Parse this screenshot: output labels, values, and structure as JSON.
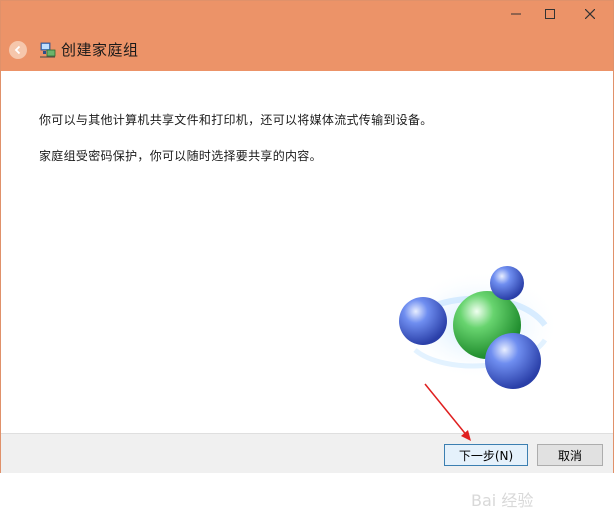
{
  "window": {
    "title": "创建家庭组",
    "controls": {
      "minimize": "—",
      "maximize": "☐",
      "close": "✕"
    }
  },
  "content": {
    "paragraph1": "你可以与其他计算机共享文件和打印机，还可以将媒体流式传输到设备。",
    "paragraph2": "家庭组受密码保护，你可以随时选择要共享的内容。"
  },
  "footer": {
    "next_label": "下一步(N)",
    "cancel_label": "取消"
  },
  "watermark": "Bai 经验",
  "colors": {
    "titlebar": "#ec9368",
    "arrow": "#e02020",
    "sphere_blue": "#3f63d6",
    "sphere_green": "#3fbf4c"
  },
  "icons": {
    "back": "back-arrow-icon",
    "app": "homegroup-icon",
    "illustration": "homegroup-spheres-icon"
  }
}
